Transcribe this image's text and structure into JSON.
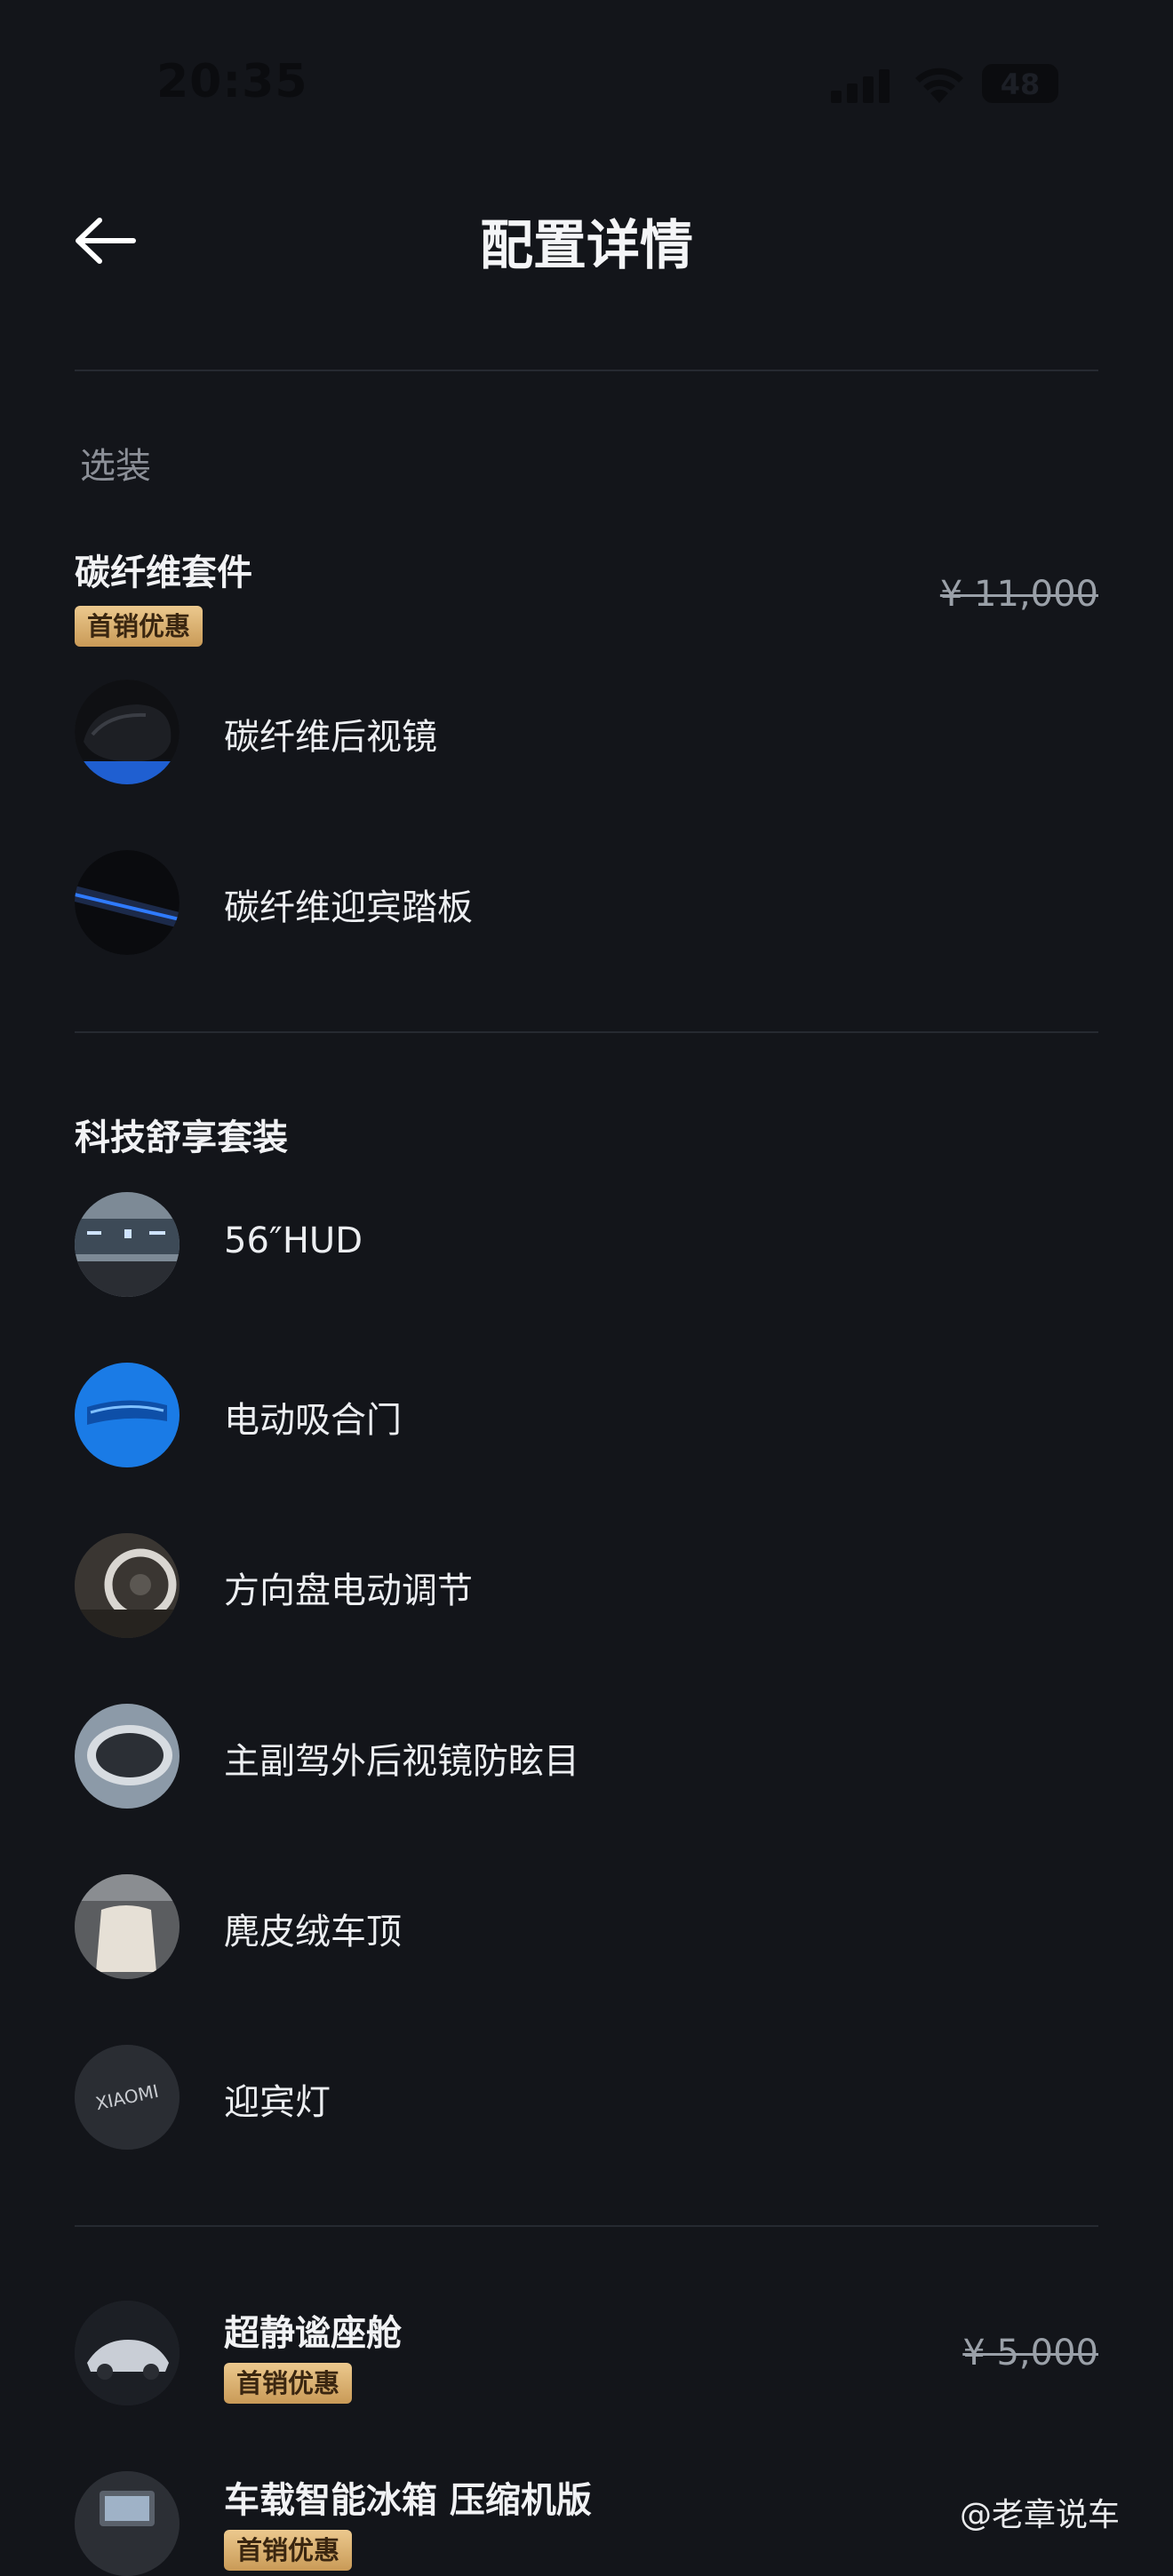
{
  "status_bar": {
    "time": "20:35",
    "battery": "48"
  },
  "header": {
    "title": "配置详情"
  },
  "section_label": "选装",
  "carbon_kit": {
    "title": "碳纤维套件",
    "badge": "首销优惠",
    "price": "¥ 11,000",
    "items": [
      {
        "label": "碳纤维后视镜",
        "icon": "carbon-mirror-thumb"
      },
      {
        "label": "碳纤维迎宾踏板",
        "icon": "carbon-sill-thumb"
      }
    ]
  },
  "tech_pack": {
    "title": "科技舒享套装",
    "items": [
      {
        "label": "56″HUD",
        "icon": "hud-thumb"
      },
      {
        "label": "电动吸合门",
        "icon": "door-handle-thumb"
      },
      {
        "label": "方向盘电动调节",
        "icon": "steering-wheel-thumb"
      },
      {
        "label": "主副驾外后视镜防眩目",
        "icon": "mirror-thumb"
      },
      {
        "label": "麂皮绒车顶",
        "icon": "suede-roof-thumb"
      },
      {
        "label": "迎宾灯",
        "icon": "welcome-light-thumb"
      }
    ],
    "welcome_light_text": "XIAOMI"
  },
  "quiet_cabin": {
    "title": "超静谧座舱",
    "badge": "首销优惠",
    "price": "¥ 5,000"
  },
  "fridge": {
    "title": "车载智能冰箱 压缩机版",
    "badge": "首销优惠"
  },
  "watermark": "@老章说车",
  "colors": {
    "background": "#13151a",
    "badge_gold": "#d8ad6b",
    "divider": "#262a31"
  }
}
